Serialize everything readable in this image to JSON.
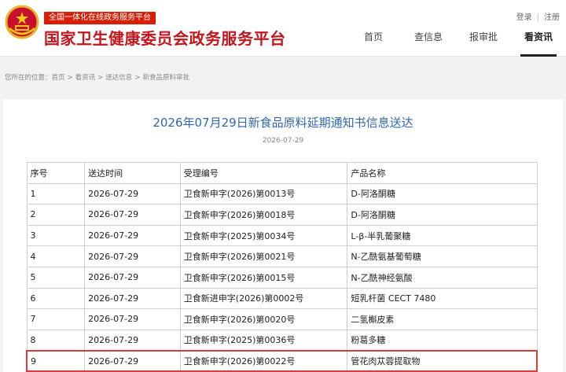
{
  "header": {
    "platform_badge": "全国一体化在线政务服务平台",
    "site_title": "国家卫生健康委员会政务服务平台",
    "login": "登录",
    "register": "注册"
  },
  "nav": [
    {
      "label": "首页",
      "active": false
    },
    {
      "label": "查信息",
      "active": false
    },
    {
      "label": "报审批",
      "active": false
    },
    {
      "label": "看资讯",
      "active": true
    }
  ],
  "breadcrumb": {
    "prefix": "您所在的位置：",
    "items": [
      "首页",
      "看资讯",
      "送达信息",
      "新食品原料审批"
    ]
  },
  "article": {
    "title": "2026年07月29日新食品原料延期通知书信息送达",
    "date": "2026-07-29"
  },
  "table": {
    "headers": [
      "序号",
      "送达时间",
      "受理编号",
      "产品名称"
    ],
    "rows": [
      [
        "1",
        "2026-07-29",
        "卫食新申字(2026)第0013号",
        "D-阿洛酮糖"
      ],
      [
        "2",
        "2026-07-29",
        "卫食新申字(2026)第0018号",
        "D-阿洛酮糖"
      ],
      [
        "3",
        "2026-07-29",
        "卫食新申字(2025)第0034号",
        "L-β-半乳葡聚糖"
      ],
      [
        "4",
        "2026-07-29",
        "卫食新申字(2026)第0021号",
        "N-乙酰氨基葡萄糖"
      ],
      [
        "5",
        "2026-07-29",
        "卫食新申字(2026)第0015号",
        "N-乙酰神经氨酸"
      ],
      [
        "6",
        "2026-07-29",
        "卫食新进申字(2026)第0002号",
        "短乳杆菌 CECT 7480"
      ],
      [
        "7",
        "2026-07-29",
        "卫食新申字(2026)第0020号",
        "二氢槲皮素"
      ],
      [
        "8",
        "2026-07-29",
        "卫食新申字(2025)第0036号",
        "粉葛多糖"
      ],
      [
        "9",
        "2026-07-29",
        "卫食新申字(2026)第0022号",
        "管花肉苁蓉提取物"
      ]
    ],
    "highlighted_row": 9
  },
  "colors": {
    "brand_red": "#c4161c",
    "title_blue": "#2f67b3",
    "highlight_red": "#e23a3a"
  }
}
